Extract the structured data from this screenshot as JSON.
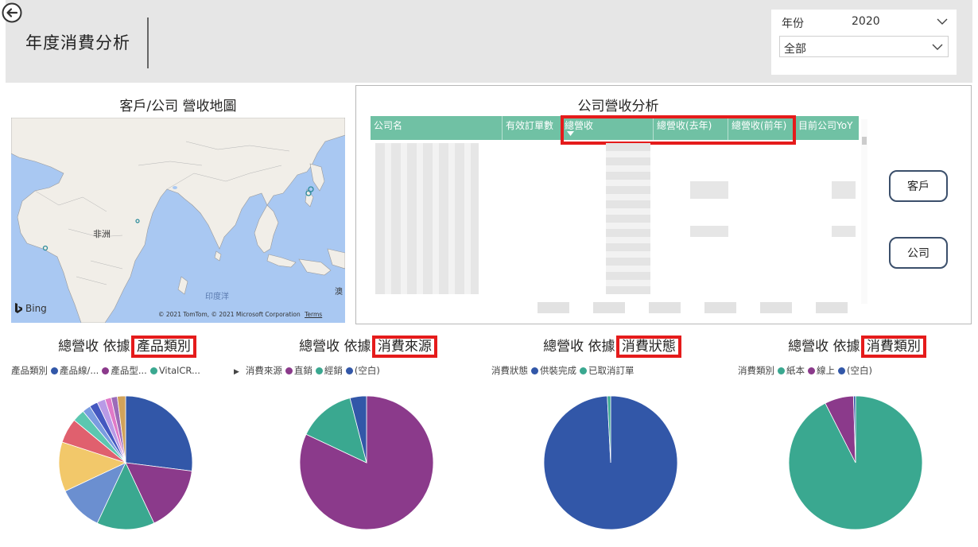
{
  "header": {
    "title": "年度消費分析"
  },
  "slicer": {
    "year_label": "年份",
    "year_value": "2020",
    "category_value": "全部"
  },
  "map": {
    "title": "客戶/公司 營收地圖",
    "label_africa": "非洲",
    "label_ocean": "印度洋",
    "label_edge": "澳",
    "bing_label": "Bing",
    "copyright": "© 2021 TomTom, © 2021 Microsoft Corporation",
    "terms": "Terms"
  },
  "table": {
    "title": "公司營收分析",
    "columns": [
      "公司名",
      "有效訂單數",
      "總營收",
      "總營收(去年)",
      "總營收(前年)",
      "目前公司YoY"
    ]
  },
  "buttons": {
    "customer": "客戶",
    "company": "公司"
  },
  "pies": [
    {
      "title_prefix": "總營收 依據",
      "title_field": "產品類別",
      "legend_label": "產品類別",
      "legend_items": [
        {
          "label": "產品線/...",
          "color": "#3257a8"
        },
        {
          "label": "產品型...",
          "color": "#8b3a8b"
        },
        {
          "label": "VitalCR...",
          "color": "#3aa890"
        }
      ]
    },
    {
      "title_prefix": "總營收 依據",
      "title_field": "消費來源",
      "legend_label": "消費來源",
      "legend_items": [
        {
          "label": "直銷",
          "color": "#8b3a8b"
        },
        {
          "label": "經銷",
          "color": "#3aa890"
        },
        {
          "label": "(空白)",
          "color": "#3257a8"
        }
      ]
    },
    {
      "title_prefix": "總營收 依據",
      "title_field": "消費狀態",
      "legend_label": "消費狀態",
      "legend_items": [
        {
          "label": "供裝完成",
          "color": "#3257a8"
        },
        {
          "label": "已取消訂單",
          "color": "#3aa890"
        }
      ]
    },
    {
      "title_prefix": "總營收 依據",
      "title_field": "消費類別",
      "legend_label": "消費類別",
      "legend_items": [
        {
          "label": "紙本",
          "color": "#3aa890"
        },
        {
          "label": "線上",
          "color": "#8b3a8b"
        },
        {
          "label": "(空白)",
          "color": "#3257a8"
        }
      ]
    }
  ],
  "chart_data": [
    {
      "type": "pie",
      "labels": [
        "產品線/...",
        "產品型...",
        "VitalCR...",
        "",
        "",
        "",
        "",
        "",
        "",
        "",
        "",
        "",
        ""
      ],
      "values": [
        27,
        16,
        14,
        11,
        12,
        6,
        3,
        2,
        2,
        2,
        1.5,
        1.5,
        2
      ],
      "colors": [
        "#3257a8",
        "#8b3a8b",
        "#3aa890",
        "#6b8fd0",
        "#f2c86a",
        "#e0606e",
        "#5cc7b0",
        "#7a9be0",
        "#4458c0",
        "#b99ae6",
        "#e07ac8",
        "#9b6bb8",
        "#d1a35a"
      ]
    },
    {
      "type": "pie",
      "labels": [
        "直銷",
        "經銷",
        "(空白)"
      ],
      "values": [
        82,
        14,
        4
      ],
      "colors": [
        "#8b3a8b",
        "#3aa890",
        "#3257a8"
      ]
    },
    {
      "type": "pie",
      "labels": [
        "供裝完成",
        "已取消訂單"
      ],
      "values": [
        99.2,
        0.8
      ],
      "colors": [
        "#3257a8",
        "#3aa890"
      ]
    },
    {
      "type": "pie",
      "labels": [
        "紙本",
        "線上",
        "(空白)"
      ],
      "values": [
        92.5,
        7,
        0.5
      ],
      "colors": [
        "#3aa890",
        "#8b3a8b",
        "#3257a8"
      ]
    }
  ]
}
